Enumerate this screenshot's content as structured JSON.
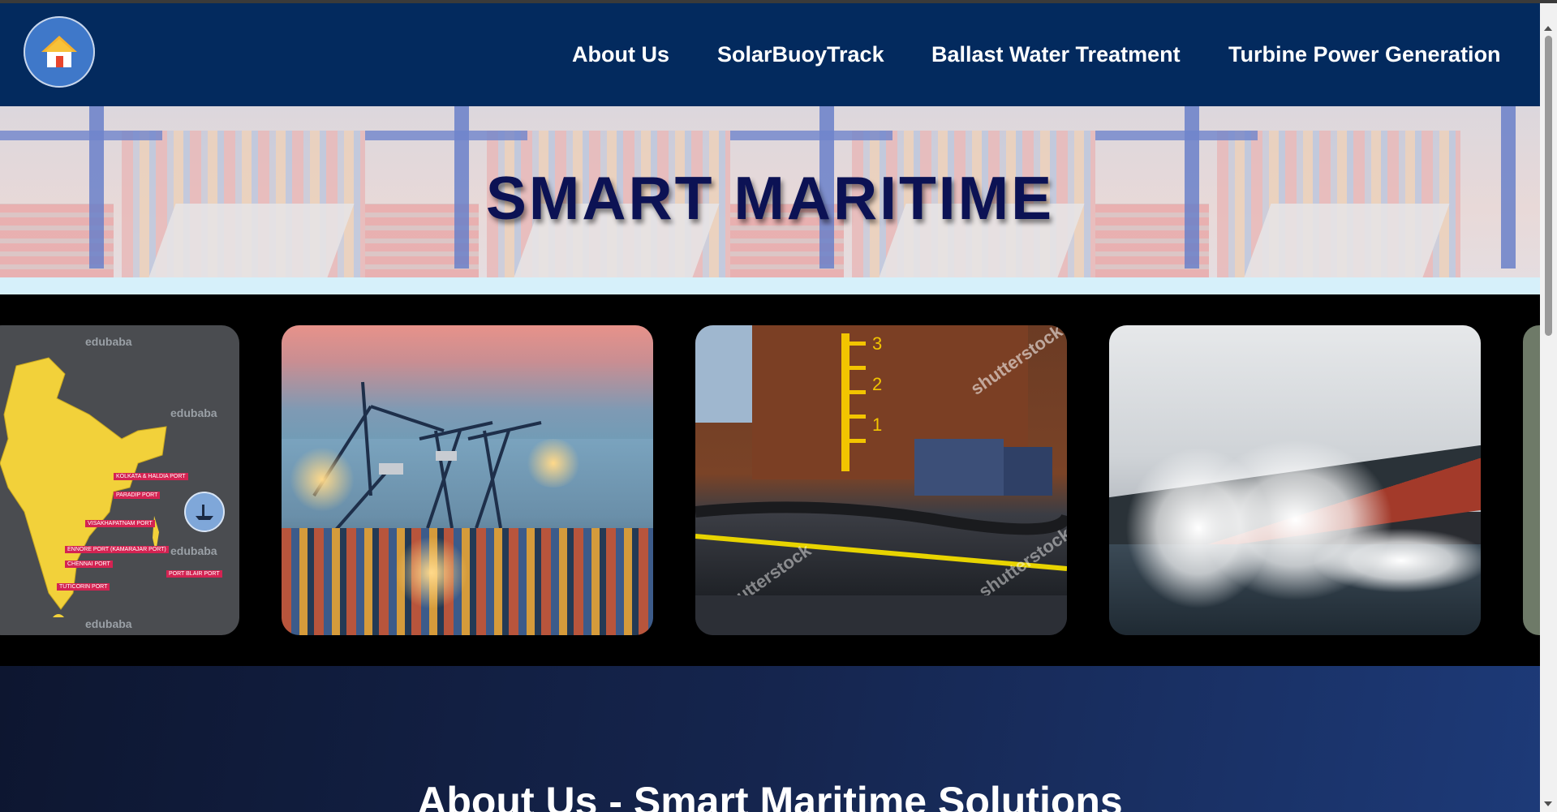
{
  "nav": {
    "home_icon": "home-icon",
    "links": [
      "About Us",
      "SolarBuoyTrack",
      "Ballast Water Treatment",
      "Turbine Power Generation"
    ]
  },
  "banner": {
    "title": "SMART MARITIME"
  },
  "carousel": {
    "map_card": {
      "watermark": "edubaba",
      "ports": [
        "KOLKATA & HALDIA PORT",
        "PARADIP PORT",
        "VISAKHAPATNAM PORT",
        "ENNORE PORT (KAMARAJAR PORT)",
        "CHENNAI PORT",
        "TUTICORIN PORT",
        "PORT BLAIR PORT"
      ]
    },
    "tank_card": {
      "watermark": "shutterstock"
    }
  },
  "about": {
    "title": "About Us - Smart Maritime Solutions"
  },
  "colors": {
    "header": "#032a5e",
    "title": "#0c1254",
    "accent_button": "#3f78c9"
  }
}
